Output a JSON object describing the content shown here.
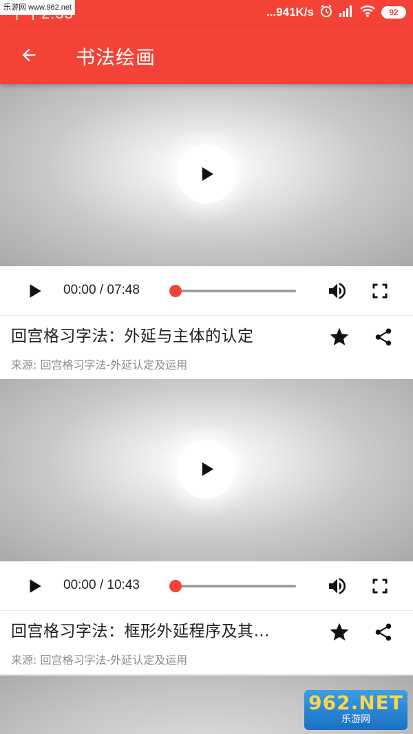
{
  "status_bar": {
    "time": "下午2:33",
    "net_speed": "...941K/s",
    "battery": "92",
    "watermark": "乐游网 www.962.net"
  },
  "app_bar": {
    "title": "书法绘画"
  },
  "videos": [
    {
      "current_time": "00:00",
      "separator": "/",
      "duration": "07:48",
      "progress": 0,
      "title": "回宫格习字法：外延与主体的认定",
      "source": "来源: 回宫格习字法-外延认定及运用"
    },
    {
      "current_time": "00:00",
      "separator": "/",
      "duration": "10:43",
      "progress": 0,
      "title": "回宫格习字法：框形外延程序及其…",
      "source": "来源: 回宫格习字法-外延认定及运用"
    }
  ],
  "watermark_br": {
    "main": "962.NET",
    "sub": "乐游网"
  },
  "colors": {
    "accent": "#f44336",
    "seek_thumb": "#f44336"
  },
  "icons": [
    "back-arrow-icon",
    "play-icon",
    "volume-icon",
    "fullscreen-icon",
    "star-icon",
    "share-icon",
    "alarm-icon",
    "signal-icon",
    "wifi-icon"
  ]
}
